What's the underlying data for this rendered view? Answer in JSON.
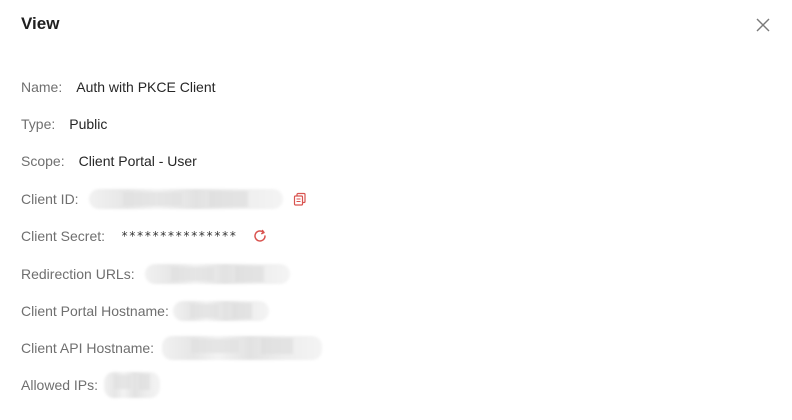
{
  "dialog": {
    "title": "View",
    "close_icon": "close-icon"
  },
  "fields": {
    "name": {
      "label": "Name:",
      "value": "Auth with PKCE Client"
    },
    "type": {
      "label": "Type:",
      "value": "Public"
    },
    "scope": {
      "label": "Scope:",
      "value": "Client Portal - User"
    },
    "client_id": {
      "label": "Client ID:",
      "copy_icon": "copy-icon"
    },
    "client_secret": {
      "label": "Client Secret:",
      "value": "***************",
      "refresh_icon": "refresh-icon"
    },
    "redirection_urls": {
      "label": "Redirection URLs:"
    },
    "client_portal_hostname": {
      "label": "Client Portal Hostname:"
    },
    "client_api_hostname": {
      "label": "Client API Hostname:"
    },
    "allowed_ips": {
      "label": "Allowed IPs:"
    }
  },
  "colors": {
    "accent": "#d9534f",
    "label": "#6f6f6f",
    "value": "#262626"
  }
}
